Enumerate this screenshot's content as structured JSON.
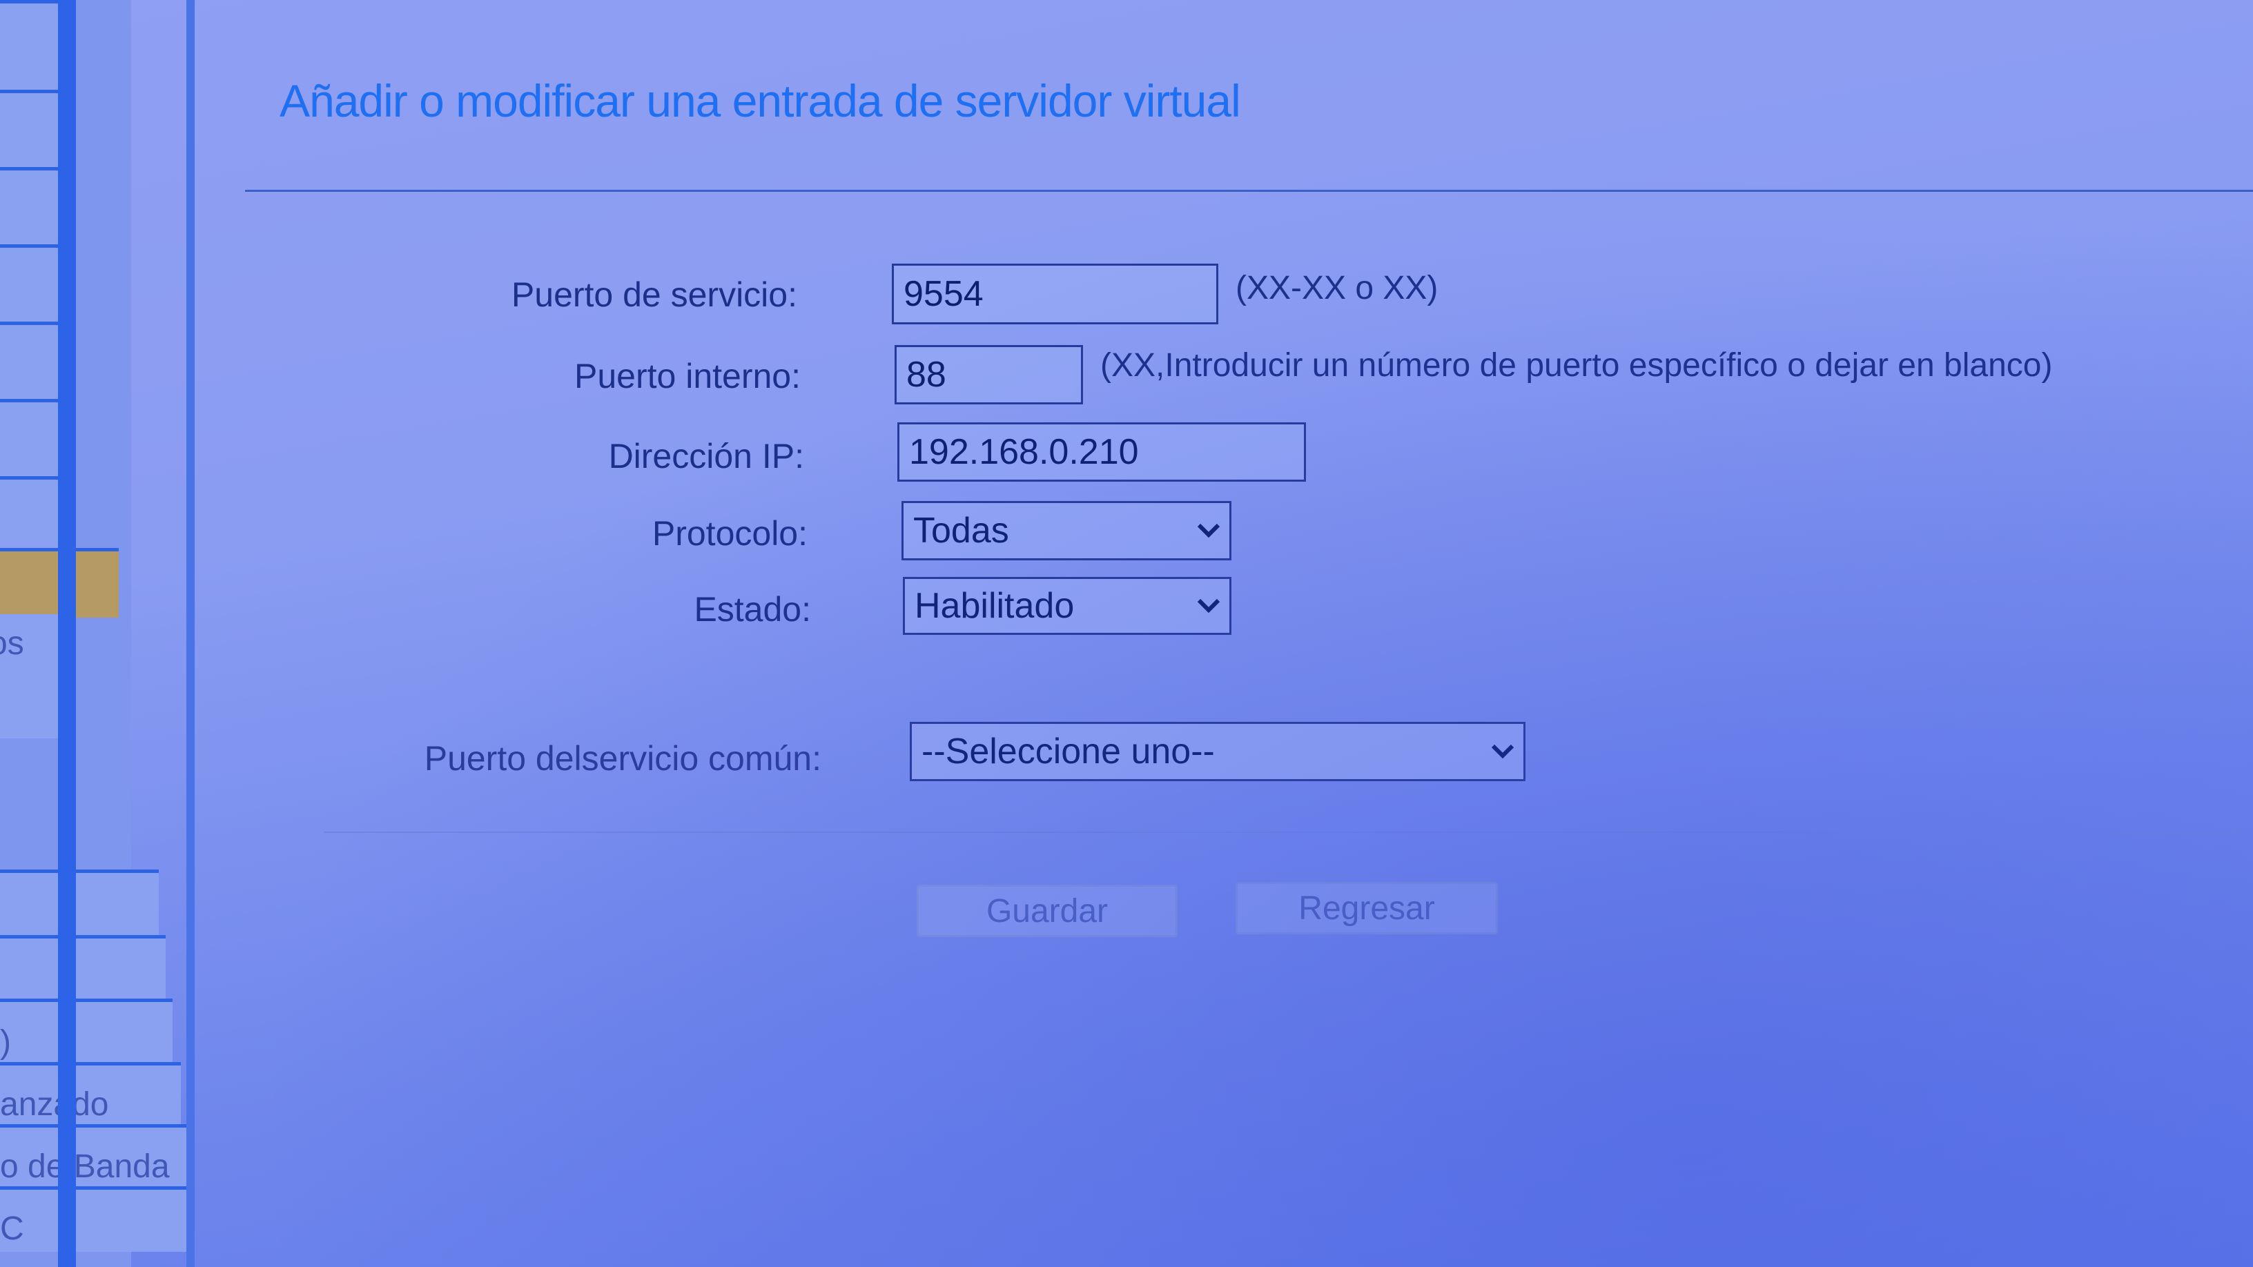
{
  "page": {
    "title": "Añadir o modificar una entrada de servidor virtual"
  },
  "sidebar": {
    "items": [
      {
        "label": "",
        "highlighted": false
      },
      {
        "label": "",
        "highlighted": false
      },
      {
        "label": "",
        "highlighted": false
      },
      {
        "label": "",
        "highlighted": false
      },
      {
        "label": "",
        "highlighted": false
      },
      {
        "label": "",
        "highlighted": false
      },
      {
        "label": "",
        "highlighted": false
      },
      {
        "label": "",
        "highlighted": true
      },
      {
        "label": "os",
        "highlighted": false
      },
      {
        "label": "",
        "highlighted": false
      },
      {
        "label": "",
        "highlighted": false
      },
      {
        "label": ")",
        "highlighted": false
      },
      {
        "label": "anzado",
        "highlighted": false
      },
      {
        "label": "o de Banda",
        "highlighted": false
      },
      {
        "label": "C",
        "highlighted": false
      }
    ]
  },
  "form": {
    "service_port": {
      "label": "Puerto de servicio:",
      "value": "9554",
      "hint": "(XX-XX o XX)"
    },
    "internal_port": {
      "label": "Puerto interno:",
      "value": "88",
      "hint": "(XX,Introducir un número de puerto específico o dejar en blanco)"
    },
    "ip_address": {
      "label": "Dirección IP:",
      "value": "192.168.0.210"
    },
    "protocol": {
      "label": "Protocolo:",
      "selected": "Todas"
    },
    "status": {
      "label": "Estado:",
      "selected": "Habilitado"
    },
    "common_service_port": {
      "label": "Puerto delservicio común:",
      "selected": "--Seleccione uno--"
    }
  },
  "buttons": {
    "save": "Guardar",
    "back": "Regresar"
  },
  "colors": {
    "background": "#8a9cf2",
    "title": "#1f6ff2",
    "sidebar_rail": "#2d63e6",
    "sidebar_highlight": "#b59a63"
  }
}
